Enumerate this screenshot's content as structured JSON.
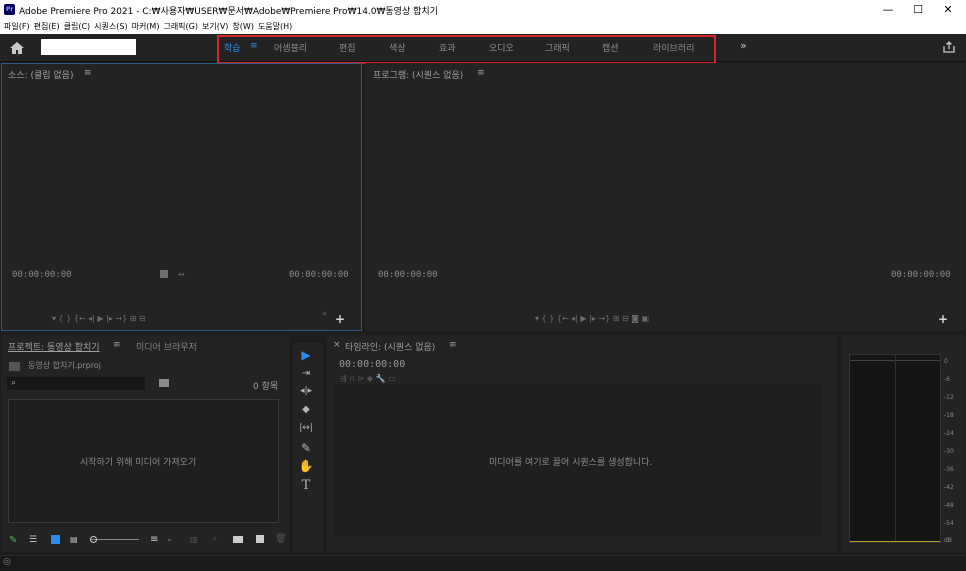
{
  "window": {
    "logo": "Pr",
    "title": "Adobe Premiere Pro 2021 - C:₩사용자₩USER₩문서₩Adobe₩Premiere Pro₩14.0₩동영상 합치기",
    "minimize_icon": "minimize-icon",
    "maximize_icon": "maximize-icon",
    "close_icon": "close-icon"
  },
  "menu": [
    "파일(F)",
    "편집(E)",
    "클립(C)",
    "시퀀스(S)",
    "마커(M)",
    "그래픽(G)",
    "보기(V)",
    "창(W)",
    "도움말(H)"
  ],
  "workspaces": {
    "active": "학습",
    "active_menu_glyph": "≡",
    "tabs": [
      "어셈블리",
      "편집",
      "색상",
      "효과",
      "오디오",
      "그래픽",
      "캡션",
      "라이브러리"
    ],
    "overflow": "»",
    "accent": "#2d8ceb",
    "highlight_color": "#d4262c"
  },
  "source_monitor": {
    "title": "소스: (클립 없음)",
    "menu_glyph": "≡",
    "timecode_left": "00:00:00:00",
    "timecode_right": "00:00:00:00",
    "controls": "▾   {   }   {←  ◂|  ▶  |▸  →}   ⊞  ⊟",
    "overflow": "»",
    "add": "+"
  },
  "program_monitor": {
    "title": "프로그램: (시퀀스 없음)",
    "menu_glyph": "≡",
    "timecode_left": "00:00:00:00",
    "timecode_right": "00:00:00:00",
    "controls": "▾   {   }   {←  ◂|  ▶  |▸  →}   ⊞  ⊟  ◙  ▣",
    "add": "+"
  },
  "project": {
    "tab_active": "프로젝트: 동영상 합치기",
    "menu_glyph": "≡",
    "tab_media_browser": "미디어 브라우저",
    "file_name": "동영상 합치기.prproj",
    "item_count": "0 항목",
    "import_hint": "시작하기 위해 미디어 가져오기"
  },
  "tools": [
    "▶",
    "⇥",
    "◂|▸",
    "◆",
    "|↔|",
    "✎",
    "✋",
    "T"
  ],
  "timeline": {
    "title": "타임라인: (시퀀스 없음)",
    "close_glyph": "×",
    "menu_glyph": "≡",
    "timecode": "00:00:00:00",
    "drop_hint": "미디어를 여기로 끌어 시퀀스를 생성합니다."
  },
  "audio_meter": {
    "ticks": [
      "0",
      "-6",
      "-12",
      "-18",
      "-24",
      "-30",
      "-36",
      "-42",
      "-48",
      "-54",
      "dB"
    ]
  }
}
